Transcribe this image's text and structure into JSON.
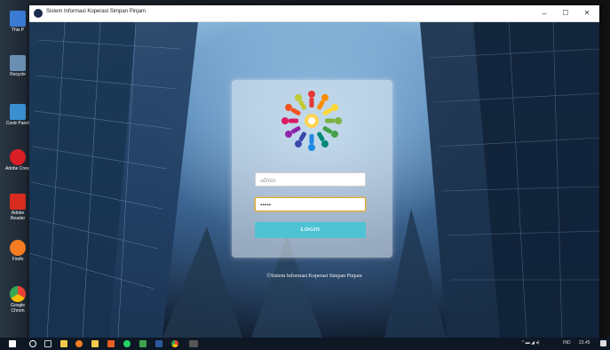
{
  "window": {
    "title": "Sistem Informasi Koperasi Simpan Pinjam",
    "minimize": "–",
    "maximize": "☐",
    "close": "✕"
  },
  "desktop_icons": [
    {
      "label": "This P",
      "icon": "computer-icon",
      "color": "#3b7bd4"
    },
    {
      "label": "Recycle",
      "icon": "recycle-bin-icon",
      "color": "#6a8fb3"
    },
    {
      "label": "Contr Panel",
      "icon": "control-panel-icon",
      "color": "#3a8fd0"
    },
    {
      "label": "Adobe Creat",
      "icon": "adobe-cc-icon",
      "color": "#da1f26"
    },
    {
      "label": "Adobe Reader",
      "icon": "adobe-reader-icon",
      "color": "#d82c20"
    },
    {
      "label": "Firefo",
      "icon": "firefox-icon",
      "color": "#f57c22"
    },
    {
      "label": "Google Chrom",
      "icon": "chrome-icon",
      "color": "#34a853"
    }
  ],
  "login": {
    "username_value": "admin",
    "password_value": "•••••",
    "login_label": "LOGIN"
  },
  "footer": "©Sistem Informasi Koperasi Simpan Pinjam",
  "taskbar": {
    "icons": [
      "windows-start-icon",
      "search-icon",
      "task-view-icon",
      "file-explorer-icon",
      "firefox-icon",
      "file-manager-icon",
      "office-icon",
      "whatsapp-icon",
      "app-icon",
      "word-icon",
      "chrome-icon",
      "app-icon-2"
    ],
    "tray_text": "IND",
    "clock": "23.45"
  },
  "colors": {
    "login_button": "#4fc3d3",
    "password_focus": "#e0a928",
    "taskbar": "#0e1724"
  }
}
